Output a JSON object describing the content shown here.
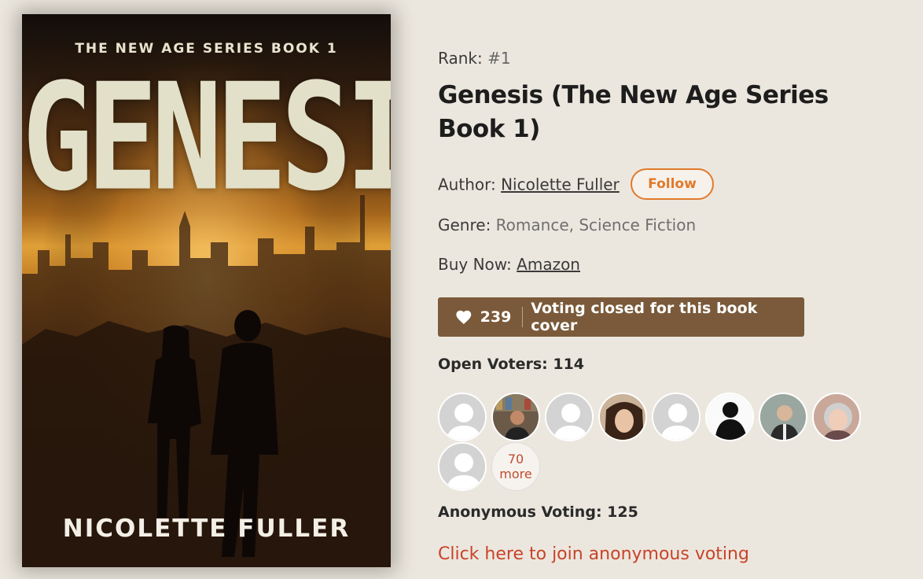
{
  "cover": {
    "series": "THE NEW AGE SERIES BOOK 1",
    "title": "GENESIS",
    "author": "NICOLETTE FULLER"
  },
  "rank": {
    "label": "Rank:",
    "value": "#1"
  },
  "book_title": "Genesis (The New Age Series Book 1)",
  "author": {
    "label": "Author:",
    "name": "Nicolette Fuller",
    "follow_label": "Follow"
  },
  "genre": {
    "label": "Genre:",
    "value": "Romance, Science Fiction"
  },
  "buy": {
    "label": "Buy Now:",
    "link": "Amazon"
  },
  "votes": {
    "count": "239",
    "status": "Voting closed for this book cover",
    "icon": "heart-icon"
  },
  "open_voters": {
    "label": "Open Voters: 114"
  },
  "voters": {
    "more_count": "70",
    "more_label": "more"
  },
  "anonymous": {
    "label": "Anonymous Voting: 125",
    "link": "Click here to join anonymous voting"
  },
  "colors": {
    "background": "#ece7de",
    "vote_bar": "#7a5a3a",
    "accent": "#e07a2c",
    "link_red": "#c8432a"
  }
}
